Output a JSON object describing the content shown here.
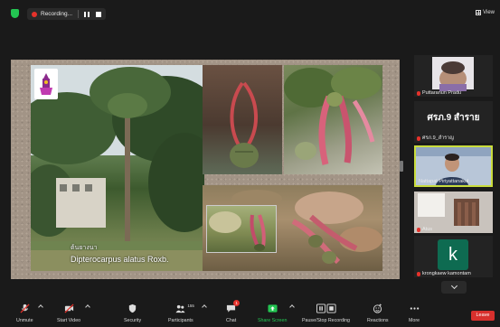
{
  "topbar": {
    "recording_label": "Recording...",
    "view_label": "View"
  },
  "slide": {
    "caption_thai": "ต้นยางนา",
    "caption_latin": "Dipterocarpus  alatus Roxb."
  },
  "participants": [
    {
      "name": "Puttaranun Pradu",
      "muted": true
    },
    {
      "name": "ศรภ.9_สำราญ",
      "display_text": "ศรภ.9  สำราย",
      "muted": true
    },
    {
      "name": "Nattapat Piriyattanakul",
      "muted": false,
      "active_speaker": true
    },
    {
      "name": "Atus",
      "muted": true
    },
    {
      "name": "krongkaew kamontam",
      "avatar_letter": "k",
      "muted": true
    }
  ],
  "toolbar": {
    "unmute": "Unmute",
    "start_video": "Start Video",
    "security": "Security",
    "participants": "Participants",
    "participants_count": "155",
    "chat": "Chat",
    "chat_badge": "1",
    "share_screen": "Share Screen",
    "pause_stop_recording": "Pause/Stop Recording",
    "reactions": "Reactions",
    "more": "More",
    "leave": "Leave"
  },
  "colors": {
    "share_green": "#23c552",
    "leave_red": "#d7302d",
    "active_speaker_border": "#c9dc3c",
    "muted_red": "#e5322b"
  },
  "icons": [
    "shield-icon",
    "record-dot-icon",
    "pause-icon",
    "stop-icon",
    "grid-view-icon",
    "microphone-muted-icon",
    "video-off-icon",
    "shield-security-icon",
    "participants-icon",
    "chat-icon",
    "share-screen-icon",
    "pause-stop-recording-icon",
    "reactions-icon",
    "more-icon",
    "chevron-down-icon"
  ]
}
